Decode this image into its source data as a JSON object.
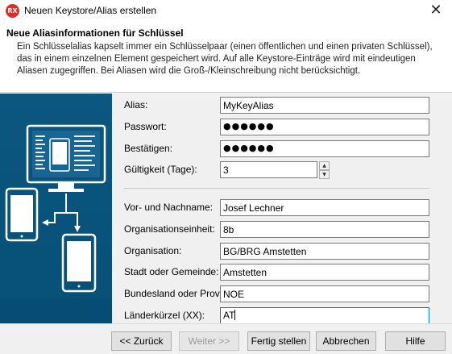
{
  "window": {
    "icon_text": "RX",
    "title": "Neuen Keystore/Alias erstellen",
    "close_glyph": "✕"
  },
  "header": {
    "title": "Neue Aliasinformationen für Schlüssel",
    "description": "Ein Schlüsselalias kapselt immer ein Schlüsselpaar (einen öffentlichen und einen privaten Schlüssel), das in einem einzelnen Element gespeichert wird. Auf alle Keystore-Einträge wird mit eindeutigen Aliasen zugegriffen. Bei Aliasen wird die Groß-/Kleinschreibung nicht berücksichtigt."
  },
  "form": {
    "alias": {
      "label": "Alias:",
      "value": "MyKeyAlias"
    },
    "password": {
      "label": "Passwort:",
      "value": "●●●●●●"
    },
    "confirm": {
      "label": "Bestätigen:",
      "value": "●●●●●●"
    },
    "validity": {
      "label": "Gültigkeit (Tage):",
      "value": "3"
    },
    "name": {
      "label": "Vor- und Nachname:",
      "value": "Josef Lechner"
    },
    "org_unit": {
      "label": "Organisationseinheit:",
      "value": "8b"
    },
    "organization": {
      "label": "Organisation:",
      "value": "BG/BRG Amstetten"
    },
    "city": {
      "label": "Stadt oder Gemeinde:",
      "value": "Amstetten"
    },
    "state": {
      "label": "Bundesland oder Provinz:",
      "value": "NOE"
    },
    "country": {
      "label": "Länderkürzel (XX):",
      "value": "AT"
    }
  },
  "buttons": {
    "back": "<< Zurück",
    "next": "Weiter >>",
    "finish": "Fertig stellen",
    "cancel": "Abbrechen",
    "help": "Hilfe"
  },
  "icons": {
    "spin_up": "▲",
    "spin_down": "▼"
  },
  "colors": {
    "illustration_bg": "#0a5780",
    "focus_border": "#0078d7"
  }
}
